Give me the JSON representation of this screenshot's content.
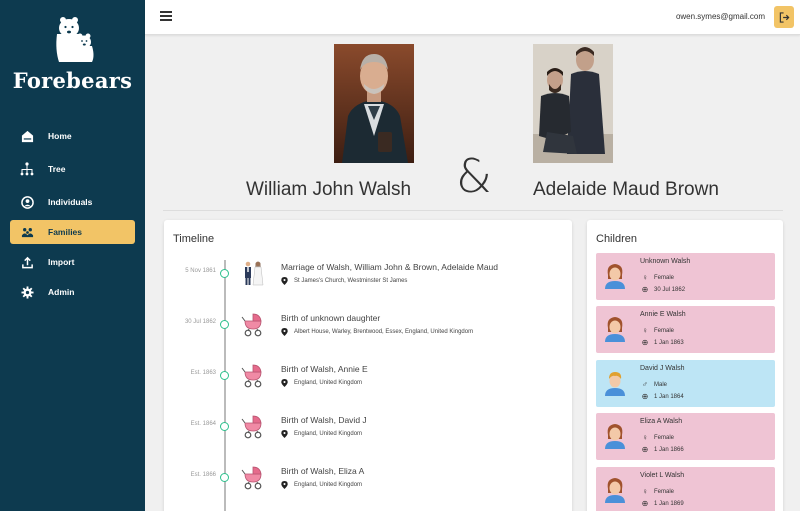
{
  "app": {
    "name": "Forebears"
  },
  "nav": [
    {
      "label": "Home",
      "icon": "home-icon"
    },
    {
      "label": "Tree",
      "icon": "tree-icon"
    },
    {
      "label": "Individuals",
      "icon": "person-icon"
    },
    {
      "label": "Families",
      "icon": "family-icon",
      "active": true
    },
    {
      "label": "Import",
      "icon": "upload-icon"
    },
    {
      "label": "Admin",
      "icon": "gear-icon"
    }
  ],
  "topbar": {
    "email": "owen.symes@gmail.com",
    "logout_icon": "logout-icon",
    "menu_icon": "hamburger-icon"
  },
  "family": {
    "partner1": "William John Walsh",
    "partner2": "Adelaide Maud Brown",
    "ampersand": "&"
  },
  "timeline": {
    "title": "Timeline",
    "events": [
      {
        "date": "5 Nov 1861",
        "title": "Marriage of Walsh, William John & Brown, Adelaide Maud",
        "place": "St James's Church, Westminster St James",
        "icon": "wedding-couple-icon"
      },
      {
        "date": "30 Jul 1862",
        "title": "Birth of unknown daughter",
        "place": "Albert House, Warley, Brentwood, Essex, England, United Kingdom",
        "icon": "pram-icon"
      },
      {
        "date": "Est. 1863",
        "title": "Birth of Walsh, Annie E",
        "place": "England, United Kingdom",
        "icon": "pram-icon"
      },
      {
        "date": "Est. 1864",
        "title": "Birth of Walsh, David J",
        "place": "England, United Kingdom",
        "icon": "pram-icon"
      },
      {
        "date": "Est. 1866",
        "title": "Birth of Walsh, Eliza A",
        "place": "England, United Kingdom",
        "icon": "pram-icon"
      }
    ]
  },
  "children": {
    "title": "Children",
    "items": [
      {
        "name": "Unknown Walsh",
        "sex": "Female",
        "born": "30 Jul 1862",
        "gender": "female"
      },
      {
        "name": "Annie E Walsh",
        "sex": "Female",
        "born": "1 Jan 1863",
        "gender": "female"
      },
      {
        "name": "David J Walsh",
        "sex": "Male",
        "born": "1 Jan 1864",
        "gender": "male"
      },
      {
        "name": "Eliza A Walsh",
        "sex": "Female",
        "born": "1 Jan 1866",
        "gender": "female"
      },
      {
        "name": "Violet L Walsh",
        "sex": "Female",
        "born": "1 Jan 1869",
        "gender": "female"
      }
    ]
  },
  "colors": {
    "sidebar": "#0d3a4f",
    "accent": "#f2c466",
    "female_card": "#efc4d4",
    "male_card": "#bde5f5",
    "timeline_dot": "#2dc08d"
  }
}
